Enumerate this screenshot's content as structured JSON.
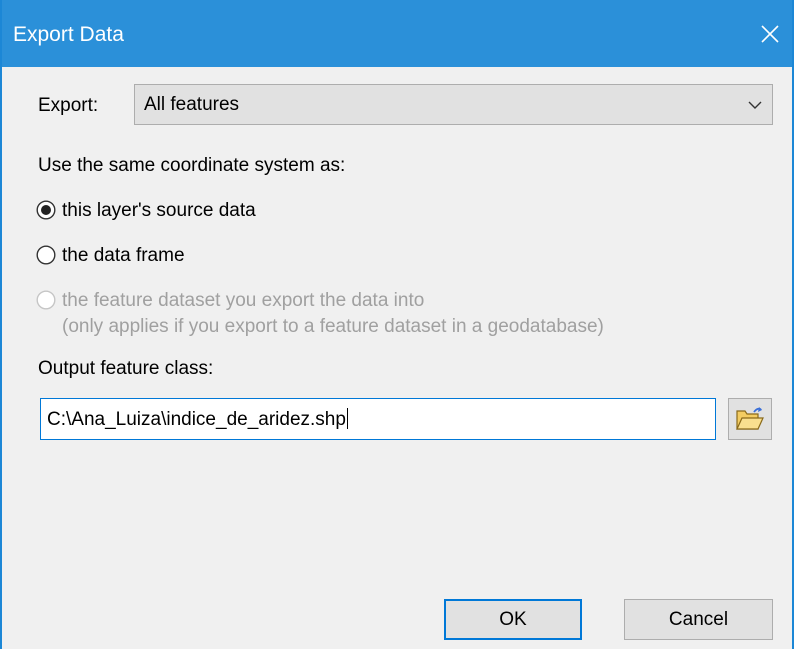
{
  "window": {
    "title": "Export Data",
    "close_glyph": "✕"
  },
  "export": {
    "label": "Export:",
    "selected": "All features"
  },
  "coordinate_system": {
    "heading": "Use the same coordinate system as:",
    "options": [
      {
        "label": "this layer's source data",
        "checked": true,
        "enabled": true
      },
      {
        "label": "the data frame",
        "checked": false,
        "enabled": true
      },
      {
        "label": "the feature dataset you export the data into",
        "sublabel": "(only applies if you export to a feature dataset in a geodatabase)",
        "checked": false,
        "enabled": false
      }
    ]
  },
  "output": {
    "label": "Output feature class:",
    "value": "C:\\Ana_Luiza\\indice_de_aridez.shp"
  },
  "buttons": {
    "ok": "OK",
    "cancel": "Cancel"
  },
  "icons": {
    "close": "close-icon",
    "dropdown": "chevron-down-icon",
    "browse": "folder-open-icon"
  },
  "colors": {
    "titlebar": "#2b90d9",
    "focus": "#0078d7"
  }
}
